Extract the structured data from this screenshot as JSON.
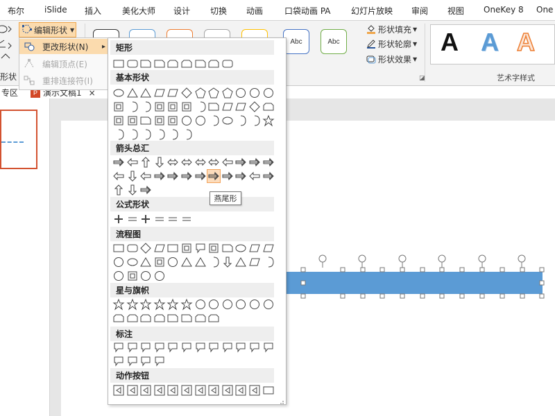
{
  "ribbon_tabs": [
    "布尔",
    "iSlide",
    "插入",
    "美化大师",
    "设计",
    "切换",
    "动画",
    "口袋动画 PA",
    "幻灯片放映",
    "审阅",
    "视图",
    "OneKey 8",
    "One"
  ],
  "toolbar": {
    "edit_shape_label": "编辑形状",
    "left_group_label": "形状",
    "style_presets": [
      "",
      "",
      "",
      "",
      "",
      "Abc",
      "Abc"
    ],
    "shape_fill": "形状填充",
    "shape_outline": "形状轮廓",
    "shape_effects": "形状效果",
    "wordart_letters": [
      "A",
      "A",
      "A"
    ],
    "wordart_group_label": "艺术字样式"
  },
  "doc_tabs": {
    "left": "专区",
    "active": "演示文稿1",
    "close": "×"
  },
  "submenu": {
    "items": [
      {
        "label": "更改形状(N)",
        "arrow": "▸",
        "disabled": false
      },
      {
        "label": "编辑顶点(E)",
        "disabled": true
      },
      {
        "label": "重排连接符(I)",
        "disabled": true
      }
    ]
  },
  "shape_gallery": {
    "categories": [
      {
        "name": "矩形",
        "count": 9
      },
      {
        "name": "基本形状",
        "count": 42
      },
      {
        "name": "箭头总汇",
        "count": 27
      },
      {
        "name": "公式形状",
        "count": 6
      },
      {
        "name": "流程图",
        "count": 28
      },
      {
        "name": "星与旗帜",
        "count": 20
      },
      {
        "name": "标注",
        "count": 16
      },
      {
        "name": "动作按钮",
        "count": 12
      }
    ],
    "hovered": "燕尾形"
  },
  "tooltip": "燕尾形",
  "colors": {
    "accent_orange": "#f0a64a",
    "hover_fill": "#fbdbae",
    "bar_blue": "#5b9bd5",
    "thumb_border": "#d35230"
  }
}
